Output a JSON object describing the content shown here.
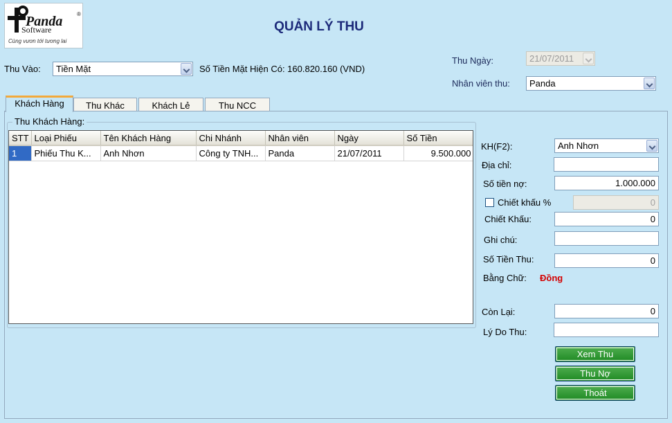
{
  "logo": {
    "line1": "Panda",
    "line2": "Software",
    "tagline": "Cùng vươn tới tương lai",
    "registered": "®"
  },
  "title": "QUẢN LÝ THU",
  "top": {
    "thu_vao_label": "Thu Vào:",
    "thu_vao_value": "Tiền Mặt",
    "so_tien_label": "Số Tiền Mặt Hiện Có: 160.820.160 (VND)",
    "thu_ngay_label": "Thu Ngày:",
    "thu_ngay_value": "21/07/2011",
    "nhan_vien_label": "Nhân viên thu:",
    "nhan_vien_value": "Panda"
  },
  "tabs": [
    {
      "label": "Khách Hàng",
      "active": true
    },
    {
      "label": "Thu Khác",
      "active": false
    },
    {
      "label": "Khách Lẻ",
      "active": false
    },
    {
      "label": "Thu NCC",
      "active": false
    }
  ],
  "group_title": "Thu Khách Hàng:",
  "grid": {
    "columns": [
      "STT",
      "Loại Phiếu",
      "Tên Khách Hàng",
      "Chi Nhánh",
      "Nhân viên",
      "Ngày",
      "Số Tiền"
    ],
    "rows": [
      [
        "1",
        "Phiếu Thu K...",
        "Anh Nhơn",
        "Công ty TNH...",
        "Panda",
        "21/07/2011",
        "9.500.000"
      ]
    ]
  },
  "form": {
    "kh_label": "KH(F2):",
    "kh_value": "Anh Nhơn",
    "dia_chi_label": "Địa chỉ:",
    "dia_chi_value": "",
    "so_tien_no_label": "Số tiền nợ:",
    "so_tien_no_value": "1.000.000",
    "chiet_khau_pct_label": "Chiết khấu %",
    "chiet_khau_pct_value": "0",
    "chiet_khau_label": "Chiết Khấu:",
    "chiet_khau_value": "0",
    "ghi_chu_label": "Ghi chú:",
    "ghi_chu_value": "",
    "so_tien_thu_label": "Số Tiền Thu:",
    "so_tien_thu_value": "0",
    "bang_chu_label": "Bằng Chữ:",
    "bang_chu_value": "Đồng",
    "con_lai_label": "Còn Lại:",
    "con_lai_value": "0",
    "ly_do_label": "Lý Do Thu:",
    "ly_do_value": ""
  },
  "buttons": {
    "xem_thu": "Xem Thu",
    "thu_no": "Thu Nợ",
    "thoat": "Thoát"
  }
}
